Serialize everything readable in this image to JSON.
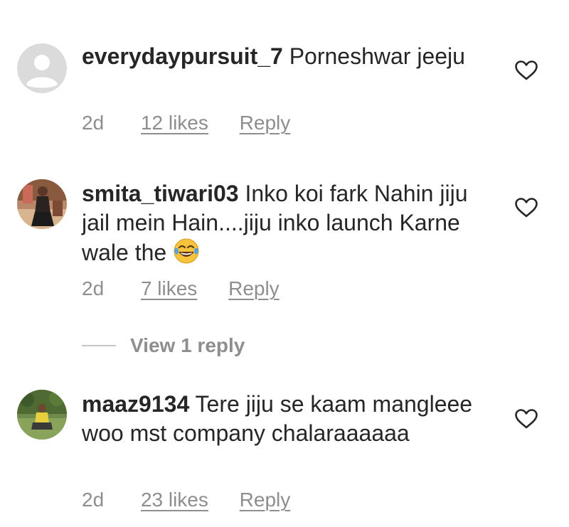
{
  "comments": [
    {
      "username": "everydaypursuit_7",
      "text": "Porneshwar jeeju",
      "emoji": "",
      "time": "2d",
      "likes": "12 likes",
      "reply": "Reply",
      "avatar": "default-avatar"
    },
    {
      "username": "smita_tiwari03",
      "text": "Inko koi fark Nahin jiju jail mein Hain....jiju inko launch Karne wale the",
      "emoji": "face-with-tears-of-joy",
      "time": "2d",
      "likes": "7 likes",
      "reply": "Reply",
      "avatar": "photo-avatar"
    },
    {
      "username": "maaz9134",
      "text": "Tere jiju se kaam mangleee woo mst company chalaraaaaaa",
      "emoji": "",
      "time": "2d",
      "likes": "23 likes",
      "reply": "Reply",
      "avatar": "photo-avatar"
    }
  ],
  "view_replies": {
    "label": "View 1 reply"
  },
  "icons": {
    "like": "heart-outline-icon"
  },
  "colors": {
    "text": "#262626",
    "secondary": "#8e8e8e",
    "divider": "#c7c7c7"
  }
}
